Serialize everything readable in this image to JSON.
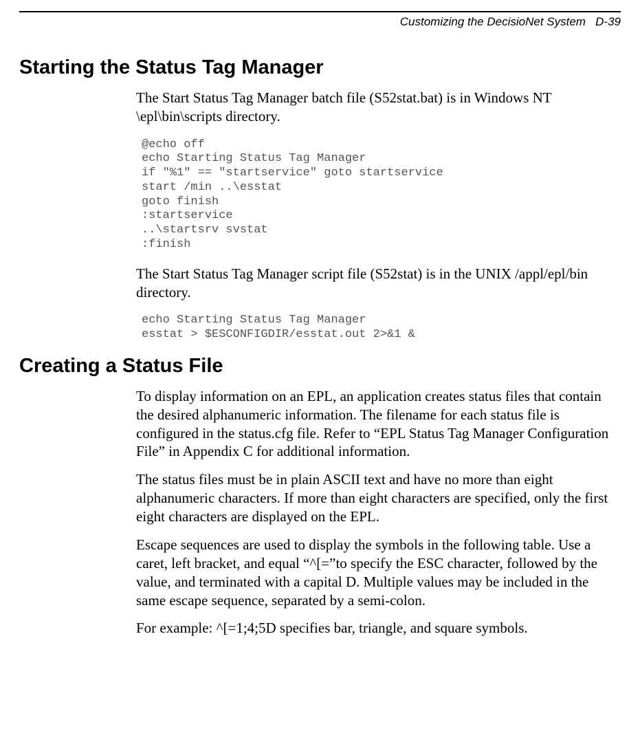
{
  "header": {
    "running_title": "Customizing the DecisioNet System",
    "page_label": "D-39"
  },
  "section1": {
    "heading": "Starting the Status Tag Manager",
    "para1": " The Start Status Tag Manager batch file (S52stat.bat) is in Windows NT \\epl\\bin\\scripts directory.",
    "code1": "@echo off\necho Starting Status Tag Manager\nif \"%1\" == \"startservice\" goto startservice\nstart /min ..\\esstat\ngoto finish\n:startservice\n..\\startsrv svstat\n:finish",
    "para2": "The Start Status Tag Manager script file (S52stat) is in the UNIX /appl/epl/bin directory.",
    "code2": "echo Starting Status Tag Manager\nesstat > $ESCONFIGDIR/esstat.out 2>&1 &"
  },
  "section2": {
    "heading": "Creating a Status File",
    "para1": "To display information on an EPL, an application creates status files that contain the desired alphanumeric information. The filename for each status file is configured in the status.cfg file. Refer to “EPL Status Tag Manager Configuration File” in Appendix C for additional information.",
    "para2": "The status files must be in plain ASCII text and have no more than eight alphanumeric characters. If more than eight characters are specified, only the first eight characters are displayed on the EPL.",
    "para3": "Escape sequences are used to display the symbols in the following table. Use a caret, left bracket, and equal “^[=”to specify the ESC character, followed by the value, and terminated with a capital D. Multiple values may be included in the same escape sequence, separated by a semi-colon.",
    "para4": "For example: ^[=1;4;5D specifies bar, triangle, and square symbols."
  }
}
